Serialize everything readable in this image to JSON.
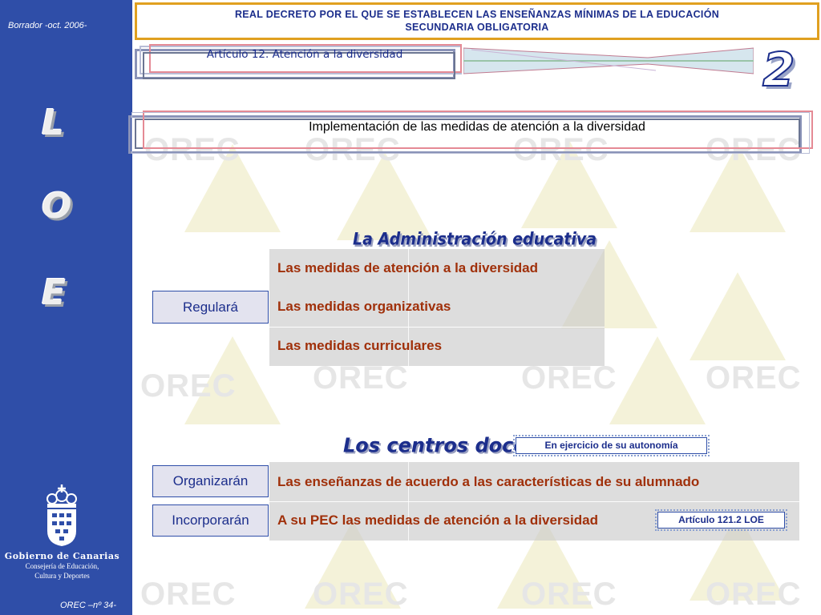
{
  "sidebar": {
    "draft_label": "Borrador -oct. 2006-",
    "letters": [
      "L",
      "O",
      "E"
    ],
    "gov_name": "Gobierno de Canarias",
    "dept_line1": "Consejería de Educación,",
    "dept_line2": "Cultura y Deportes",
    "page_label": "OREC –nº 34-"
  },
  "header": {
    "title_line1": "REAL DECRETO POR EL QUE SE ESTABLECEN LAS ENSEÑANZAS MÍNIMAS DE LA EDUCACIÓN",
    "title_line2": "SECUNDARIA OBLIGATORIA",
    "article": "Artículo 12.  Atención a la diversidad",
    "number": "2"
  },
  "subtitle": "Implementación de las medidas de atención a la diversidad",
  "watermark": "OREC",
  "administracion": {
    "title": "La Administración educativa",
    "verb": "Regulará",
    "rows": [
      "Las medidas de atención a la diversidad",
      "Las medidas organizativas",
      "Las medidas curriculares"
    ]
  },
  "centros": {
    "title": "Los centros docentes",
    "autonomy_tag": "En ejercicio de su autonomía",
    "verbs": [
      "Organizarán",
      "Incorporarán"
    ],
    "rows": [
      "Las enseñanzas de acuerdo a las características de su alumnado",
      "A su PEC las medidas de atención a la diversidad"
    ],
    "loe_tag": "Artículo 121.2 LOE"
  },
  "colors": {
    "sidebar_bg": "#2f4ea8",
    "title_blue": "#1c2e8c",
    "row_text": "#a0300a",
    "header_border": "#e0a020"
  }
}
